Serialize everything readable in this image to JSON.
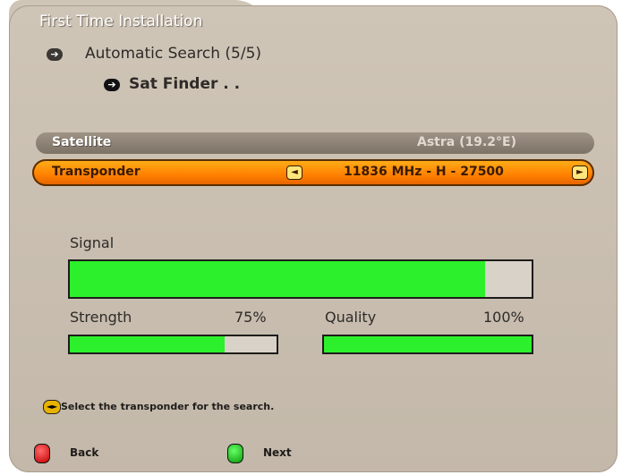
{
  "header": {
    "title": "First Time Installation",
    "step": "Automatic Search (5/5)",
    "substep": "Sat Finder . ."
  },
  "satellite": {
    "label": "Satellite",
    "value": "Astra (19.2°E)"
  },
  "transponder": {
    "label": "Transponder",
    "value": "11836 MHz - H - 27500",
    "left_arrow": "◄",
    "right_arrow": "►"
  },
  "signal": {
    "label": "Signal",
    "level_fraction": 0.9
  },
  "strength": {
    "label": "Strength",
    "value": "75%",
    "level_fraction": 0.75
  },
  "quality": {
    "label": "Quality",
    "value": "100%",
    "level_fraction": 1.0
  },
  "help": {
    "text": "Select the transponder for the search."
  },
  "footer": {
    "back_label": "Back",
    "next_label": "Next"
  },
  "colors": {
    "panel": "#cfc5b7",
    "highlight": "#ff8c00",
    "level": "#2cf02c",
    "red_button": "#d80000",
    "green_button": "#10a010"
  },
  "icons": {
    "nav_arrow": "arrow-right-icon",
    "help": "left-right-key-icon",
    "back": "red-key-icon",
    "next": "green-key-icon"
  }
}
